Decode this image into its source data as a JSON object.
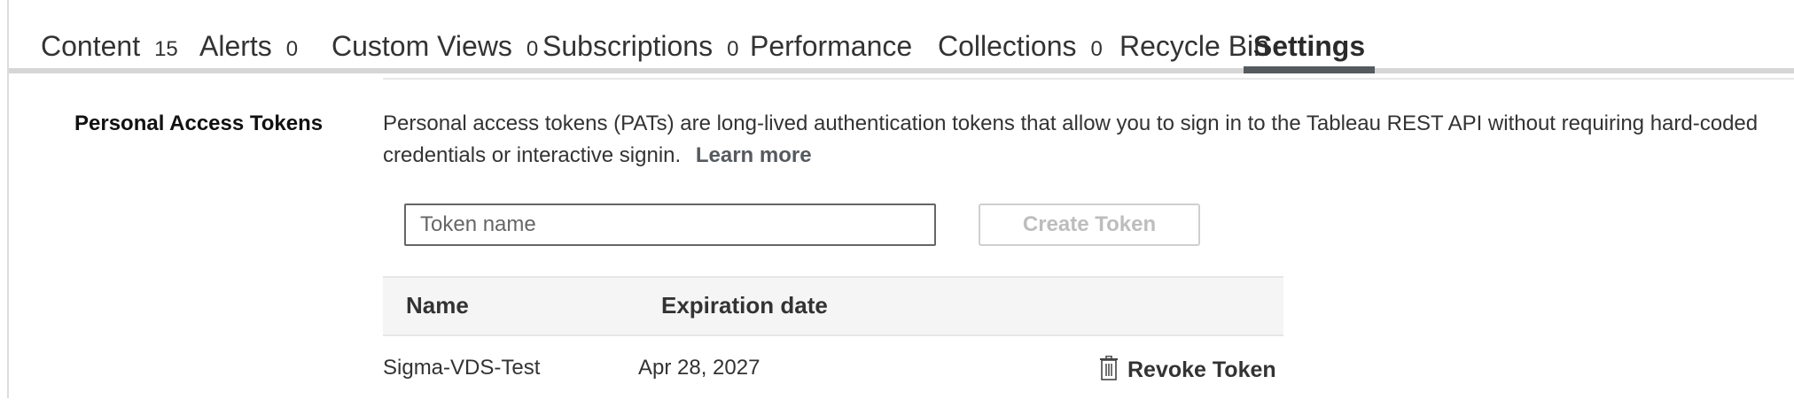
{
  "tabs": [
    {
      "label": "Content",
      "count": "15",
      "active": false
    },
    {
      "label": "Alerts",
      "count": "0",
      "active": false
    },
    {
      "label": "Custom Views",
      "count": "0",
      "active": false
    },
    {
      "label": "Subscriptions",
      "count": "0",
      "active": false
    },
    {
      "label": "Performance",
      "count": "",
      "active": false
    },
    {
      "label": "Collections",
      "count": "0",
      "active": false
    },
    {
      "label": "Recycle Bin",
      "count": "",
      "active": false
    },
    {
      "label": "Settings",
      "count": "",
      "active": true
    }
  ],
  "settings": {
    "section_title": "Personal Access Tokens",
    "description": "Personal access tokens (PATs) are long-lived authentication tokens that allow you to sign in to the Tableau REST API without requiring hard-coded credentials or interactive signin.",
    "learn_more": "Learn more",
    "token_input": {
      "placeholder": "Token name",
      "value": ""
    },
    "create_button": "Create Token",
    "create_button_enabled": false
  },
  "token_table": {
    "columns": [
      "Name",
      "Expiration date"
    ],
    "rows": [
      {
        "name": "Sigma-VDS-Test",
        "expiration": "Apr 28, 2027",
        "action": "Revoke Token",
        "action_icon": "trash-icon"
      }
    ]
  },
  "colors": {
    "active_tab_underline": "#555a5e",
    "learn_more": "#555a5e",
    "disabled_button_text": "#bdbdbd"
  }
}
